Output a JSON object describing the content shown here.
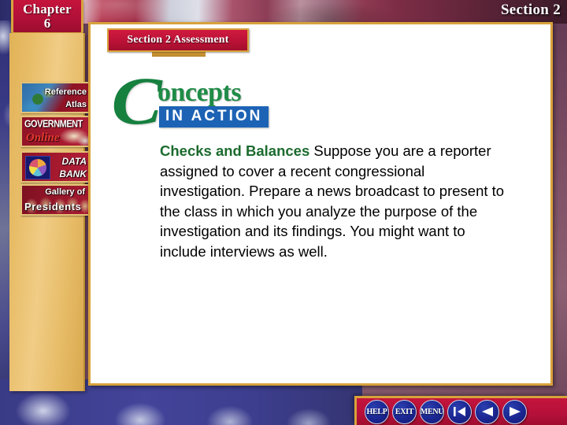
{
  "header": {
    "chapter_word": "Chapter",
    "chapter_number": "6",
    "section_label": "Section 2"
  },
  "sidebar": {
    "items": [
      {
        "name": "reference-atlas",
        "line1": "Reference",
        "line2": "Atlas"
      },
      {
        "name": "government-online",
        "line1": "GOVERNMENT",
        "line2": "Online"
      },
      {
        "name": "data-bank",
        "line1": "DATA",
        "line2": "BANK"
      },
      {
        "name": "gallery-of-presidents",
        "line1": "Gallery of",
        "line2": "Presidents"
      }
    ]
  },
  "content": {
    "assessment_banner": "Section 2 Assessment",
    "logo": {
      "initial": "C",
      "word": "oncepts",
      "subtitle": "IN ACTION"
    },
    "body": {
      "lead": "Checks and Balances",
      "text": " Suppose you are a reporter assigned to cover a recent congressional investigation. Prepare a news broadcast to present to the class in which you analyze the purpose of the investigation and its findings. You might want to include interviews as well."
    }
  },
  "navbar": {
    "buttons": [
      {
        "name": "help-button",
        "label": "HELP",
        "icon": ""
      },
      {
        "name": "exit-button",
        "label": "EXIT",
        "icon": ""
      },
      {
        "name": "menu-button",
        "label": "MENU",
        "icon": ""
      },
      {
        "name": "first-page-button",
        "label": "",
        "icon": "first-page-arrow-icon"
      },
      {
        "name": "previous-button",
        "label": "",
        "icon": "back-arrow-icon"
      },
      {
        "name": "next-button",
        "label": "",
        "icon": "forward-arrow-icon"
      }
    ]
  },
  "colors": {
    "gold": "#d8a23c",
    "crimson": "#b4103a",
    "panel_gold": "#e8bd68",
    "logo_green": "#1f8c47",
    "logo_blue": "#1d63b5",
    "button_blue": "#1a2590"
  }
}
